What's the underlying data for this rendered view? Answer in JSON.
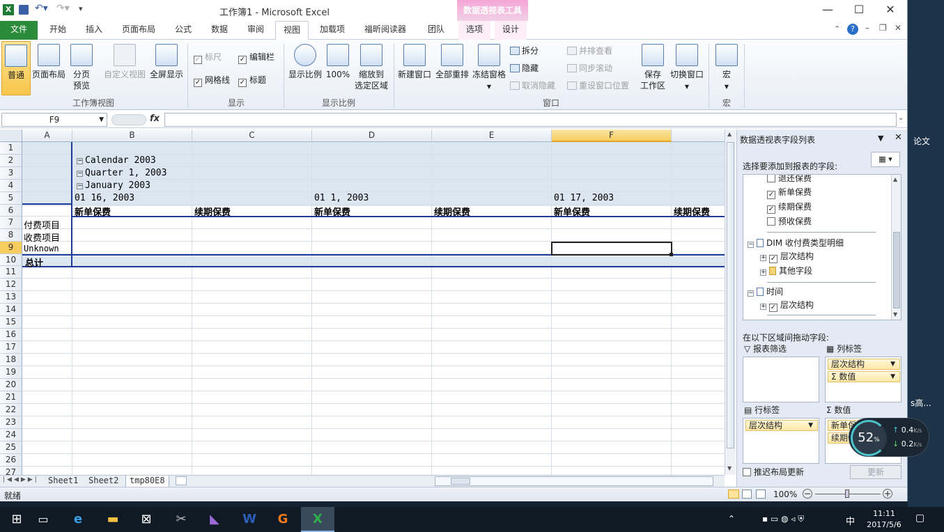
{
  "window": {
    "title": "工作簿1 - Microsoft Excel",
    "context_tools": "数据透视表工具",
    "minimize": "—",
    "maximize": "☐",
    "close": "✕"
  },
  "tabs": [
    "文件",
    "开始",
    "插入",
    "页面布局",
    "公式",
    "数据",
    "审阅",
    "视图",
    "加载项",
    "福昕阅读器",
    "团队",
    "选项",
    "设计"
  ],
  "active_tab": "视图",
  "ribbon": {
    "workbook_views": {
      "label": "工作簿视图",
      "normal": "普通",
      "page_layout": "页面布局",
      "page_break": "分页\n预览",
      "custom_views": "自定义视图",
      "full_screen": "全屏显示"
    },
    "show": {
      "label": "显示",
      "ruler": "标尺",
      "gridlines": "网格线",
      "formula_bar": "编辑栏",
      "headings": "标题"
    },
    "zoom": {
      "label": "显示比例",
      "zoom": "显示比例",
      "hundred": "100%",
      "zoom_to_sel": "缩放到\n选定区域"
    },
    "window": {
      "label": "窗口",
      "new_window": "新建窗口",
      "arrange_all": "全部重排",
      "freeze": "冻结窗格",
      "split": "拆分",
      "hide": "隐藏",
      "unhide": "取消隐藏",
      "side_by_side": "并排查看",
      "sync_scroll": "同步滚动",
      "reset_pos": "重设窗口位置",
      "save_ws": "保存\n工作区",
      "switch": "切换窗口"
    },
    "macros": {
      "label": "宏",
      "macros": "宏"
    }
  },
  "formula_bar": {
    "name_box": "F9",
    "fx": "fx",
    "value": ""
  },
  "grid": {
    "columns": [
      "A",
      "B",
      "C",
      "D",
      "E",
      "F"
    ],
    "selected_column": "F",
    "rows": [
      "1",
      "2",
      "3",
      "4",
      "5",
      "6",
      "7",
      "8",
      "9",
      "10",
      "11",
      "12",
      "13",
      "14",
      "15",
      "16",
      "17",
      "18",
      "19",
      "20",
      "21",
      "22",
      "23",
      "24",
      "25",
      "26",
      "27"
    ],
    "selected_row": "9",
    "pivot": {
      "calendar": "Calendar 2003",
      "quarter": "Quarter 1, 2003",
      "month": "January 2003",
      "dates": [
        "01 16, 2003",
        "01 1, 2003",
        "01 17, 2003"
      ],
      "measures": [
        "新单保费",
        "续期保费",
        "新单保费",
        "续期保费",
        "新单保费",
        "续期保费"
      ],
      "row_items": [
        "付费项目",
        "收费项目",
        "Unknown"
      ],
      "total": "总计"
    }
  },
  "sheets": [
    "Sheet1",
    "Sheet2",
    "tmp80E8"
  ],
  "active_sheet": "tmp80E8",
  "status": {
    "ready": "就绪",
    "zoom": "100%"
  },
  "pane": {
    "title": "数据透视表字段列表",
    "choose_fields": "选择要添加到报表的字段:",
    "fields": [
      {
        "label": "退还保费",
        "checked": false
      },
      {
        "label": "新单保费",
        "checked": true
      },
      {
        "label": "续期保费",
        "checked": true
      },
      {
        "label": "预收保费",
        "checked": false
      }
    ],
    "dim_group": "DIM 收付费类型明细",
    "dim_hier": "层次结构",
    "dim_other": "其他字段",
    "time_group": "时间",
    "time_hier": "层次结构",
    "drag_label": "在以下区域间拖动字段:",
    "report_filter": "报表筛选",
    "col_labels": "列标签",
    "row_labels": "行标签",
    "values": "数值",
    "col_chips": [
      "层次结构",
      "Σ 数值"
    ],
    "row_chips": [
      "层次结构"
    ],
    "value_chips": [
      "新单保费",
      "续期保费"
    ],
    "defer": "推迟布局更新",
    "update": "更新"
  },
  "desktop": {
    "right_text_1": "论文",
    "right_text_2": "s高...",
    "net_percent": "52",
    "net_pct_sign": "%",
    "up_speed": "0.4",
    "down_speed": "0.2",
    "speed_unit": "K/s"
  },
  "taskbar": {
    "time": "11:11",
    "date": "2017/5/6",
    "ime": "中"
  }
}
